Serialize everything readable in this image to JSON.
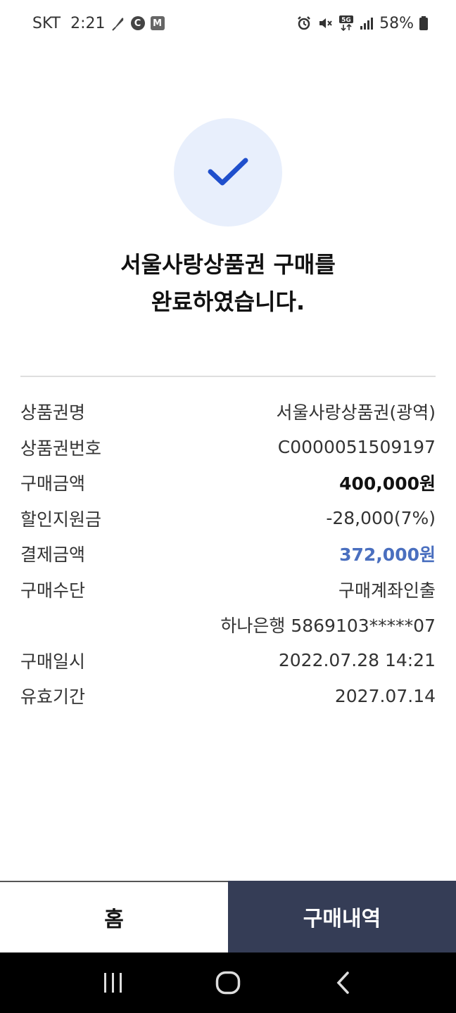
{
  "status_bar": {
    "carrier": "SKT",
    "time": "2:21",
    "battery": "58%",
    "network": "5G",
    "icons_left": [
      "feather-icon",
      "c-badge-icon",
      "m-badge-icon"
    ],
    "icons_right": [
      "alarm-icon",
      "mute-icon",
      "5g-icon",
      "signal-icon",
      "battery-icon"
    ]
  },
  "title": {
    "line1": "서울사랑상품권 구매를",
    "line2": "완료하였습니다."
  },
  "details": {
    "voucher_name": {
      "label": "상품권명",
      "value": "서울사랑상품권(광역)"
    },
    "voucher_number": {
      "label": "상품권번호",
      "value": "C0000051509197"
    },
    "purchase_amount": {
      "label": "구매금액",
      "value": "400,000원"
    },
    "discount": {
      "label": "할인지원금",
      "value": "-28,000(7%)"
    },
    "payment_amount": {
      "label": "결제금액",
      "value": "372,000원"
    },
    "payment_method": {
      "label": "구매수단",
      "value": "구매계좌인출"
    },
    "account": {
      "label": "",
      "value": "하나은행 5869103*****07"
    },
    "purchase_date": {
      "label": "구매일시",
      "value": "2022.07.28 14:21"
    },
    "valid_until": {
      "label": "유효기간",
      "value": "2027.07.14"
    }
  },
  "buttons": {
    "home": "홈",
    "history": "구매내역"
  },
  "colors": {
    "accent": "#4a6fbf",
    "check": "#1f4fcc",
    "check_bg": "#e8effc",
    "history_bg": "#353d56"
  }
}
